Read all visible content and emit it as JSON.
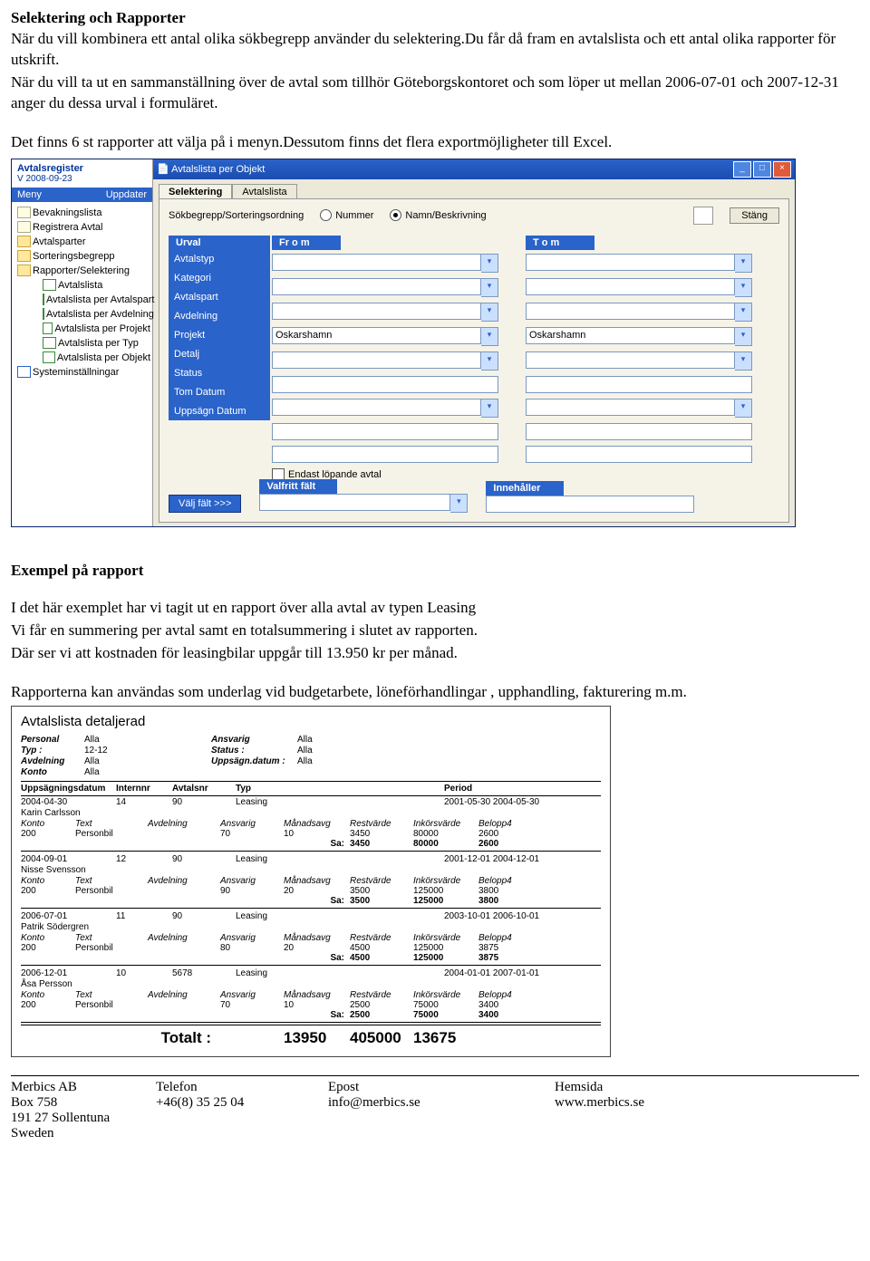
{
  "doc": {
    "h1": "Selektering och Rapporter",
    "p1": "När du vill kombinera ett antal olika sökbegrepp använder du selektering.Du får då fram en avtalslista och ett antal olika rapporter för utskrift.",
    "p2": "När du vill ta ut en sammanställning över de avtal som tillhör Göteborgskontoret och som löper ut mellan 2006-07-01 och 2007-12-31 anger du dessa urval i formuläret.",
    "p3": "Det finns 6 st rapporter att välja på i menyn.Dessutom finns det flera exportmöjligheter till Excel.",
    "h2": "Exempel på rapport",
    "p4": "I det här exemplet har vi tagit ut en rapport över alla avtal av typen Leasing",
    "p5": "Vi får en summering per avtal samt en totalsummering i slutet av rapporten.",
    "p6": "Där ser vi att kostnaden för leasingbilar uppgår till 13.950 kr per månad.",
    "p7": "Rapporterna kan användas som underlag vid budgetarbete, löneförhandlingar , upphandling, fakturering m.m."
  },
  "app": {
    "brand": "Avtalsregister",
    "version": "V 2008-09-23",
    "menu_left": "Meny",
    "menu_right": "Uppdater",
    "tree": {
      "n0": "Bevakningslista",
      "n1": "Registrera Avtal",
      "n2": "Avtalsparter",
      "n3": "Sorteringsbegrepp",
      "n4": "Rapporter/Selektering",
      "n4a": "Avtalslista",
      "n4b": "Avtalslista per Avtalspart",
      "n4c": "Avtalslista per Avdelning",
      "n4d": "Avtalslista per Projekt",
      "n4e": "Avtalslista per Typ",
      "n4f": "Avtalslista per Objekt",
      "n5": "Systeminställningar"
    },
    "window_title": "Avtalslista per Objekt",
    "tabs": {
      "t1": "Selektering",
      "t2": "Avtalslista"
    },
    "search_label": "Sökbegrepp/Sorteringsordning",
    "radio_nummer": "Nummer",
    "radio_namn": "Namn/Beskrivning",
    "btn_close": "Stäng",
    "col_urval": "Urval",
    "col_from": "Fr o m",
    "col_tom": "T o m",
    "labels": {
      "l0": "Avtalstyp",
      "l1": "Kategori",
      "l2": "Avtalspart",
      "l3": "Avdelning",
      "l4": "Projekt",
      "l5": "Detalj",
      "l6": "Status",
      "l7": "Tom Datum",
      "l8": "Uppsägn Datum"
    },
    "val_avdelning_from": "Oskarshamn",
    "val_avdelning_tom": "Oskarshamn",
    "chk_lopande": "Endast löpande avtal",
    "btn_valj": "Välj fält >>>",
    "lbl_valfritt": "Valfritt fält",
    "lbl_innehaller": "Innehåller"
  },
  "report": {
    "title": "Avtalslista detaljerad",
    "hdr": {
      "personal_l": "Personal",
      "personal_v": "Alla",
      "ansvarig_l": "Ansvarig",
      "ansvarig_v": "Alla",
      "typ_l": "Typ :",
      "typ_v": "12-12",
      "status_l": "Status :",
      "status_v": "Alla",
      "avdelning_l": "Avdelning",
      "avdelning_v": "Alla",
      "uppsagn_l": "Uppsägn.datum :",
      "uppsagn_v": "Alla",
      "konto_l": "Konto",
      "konto_v": "Alla"
    },
    "thead": {
      "c1": "Uppsägningsdatum",
      "c2": "Internnr",
      "c3": "Avtalsnr",
      "c4": "Typ",
      "c5": "",
      "c6": "Period"
    },
    "subcols": {
      "c1": "Konto",
      "c2": "Text",
      "c3": "Avdelning",
      "c4": "Ansvarig",
      "c5": "Månadsavg",
      "c6": "Restvärde",
      "c7": "Inkörsvärde",
      "c8": "Belopp4"
    },
    "sa": "Sa:",
    "groups": [
      {
        "r1": {
          "c1": "2004-04-30",
          "c2": "14",
          "c3": "90",
          "c4": "Leasing",
          "c6": "2001-05-30 2004-05-30"
        },
        "name": "Karin Carlsson",
        "v": {
          "c1": "200",
          "c2": "Personbil",
          "c3": "",
          "c4": "70",
          "c5": "10",
          "c6": "3450",
          "c7": "80000",
          "c8": "2600"
        },
        "s": {
          "c5": "",
          "c6": "3450",
          "c7": "80000",
          "c8": "2600"
        }
      },
      {
        "r1": {
          "c1": "2004-09-01",
          "c2": "12",
          "c3": "90",
          "c4": "Leasing",
          "c6": "2001-12-01 2004-12-01"
        },
        "name": "Nisse Svensson",
        "v": {
          "c1": "200",
          "c2": "Personbil",
          "c3": "",
          "c4": "90",
          "c5": "20",
          "c6": "3500",
          "c7": "125000",
          "c8": "3800"
        },
        "s": {
          "c5": "",
          "c6": "3500",
          "c7": "125000",
          "c8": "3800"
        }
      },
      {
        "r1": {
          "c1": "2006-07-01",
          "c2": "11",
          "c3": "90",
          "c4": "Leasing",
          "c6": "2003-10-01 2006-10-01"
        },
        "name": "Patrik Södergren",
        "v": {
          "c1": "200",
          "c2": "Personbil",
          "c3": "",
          "c4": "80",
          "c5": "20",
          "c6": "4500",
          "c7": "125000",
          "c8": "3875"
        },
        "s": {
          "c5": "",
          "c6": "4500",
          "c7": "125000",
          "c8": "3875"
        }
      },
      {
        "r1": {
          "c1": "2006-12-01",
          "c2": "10",
          "c3": "5678",
          "c4": "Leasing",
          "c6": "2004-01-01 2007-01-01"
        },
        "name": "Åsa Persson",
        "v": {
          "c1": "200",
          "c2": "Personbil",
          "c3": "",
          "c4": "70",
          "c5": "10",
          "c6": "2500",
          "c7": "75000",
          "c8": "3400"
        },
        "s": {
          "c5": "",
          "c6": "2500",
          "c7": "75000",
          "c8": "3400"
        }
      }
    ],
    "total_l": "Totalt :",
    "total": {
      "c6": "13950",
      "c7": "405000",
      "c8": "13675"
    }
  },
  "footer": {
    "c1a": "Merbics AB",
    "c1b": "Box 758",
    "c1c": "191 27 Sollentuna",
    "c1d": "Sweden",
    "c2a": "Telefon",
    "c2b": "+46(8) 35 25 04",
    "c3a": "Epost",
    "c3b": "info@merbics.se",
    "c4a": "Hemsida",
    "c4b": "www.merbics.se"
  }
}
